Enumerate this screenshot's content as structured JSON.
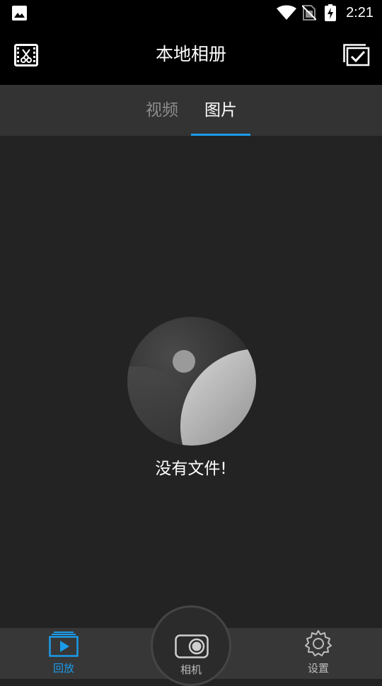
{
  "status_bar": {
    "time": "2:21",
    "icons": [
      "gallery-icon",
      "wifi-icon",
      "no-sim-icon",
      "battery-charging-icon"
    ]
  },
  "app_bar": {
    "title": "本地相册",
    "left_icon": "film-edit-icon",
    "right_icon": "multi-select-icon"
  },
  "tabs": [
    {
      "label": "视频",
      "active": false
    },
    {
      "label": "图片",
      "active": true
    }
  ],
  "empty_state": {
    "message": "没有文件!",
    "icon": "empty-gallery-icon"
  },
  "bottom_nav": {
    "playback_label": "回放",
    "camera_label": "相机",
    "settings_label": "设置"
  },
  "colors": {
    "accent": "#1a9bea",
    "background": "#232323",
    "bar": "#000000",
    "tab_bar": "#333333",
    "bottom_nav": "#373737"
  }
}
